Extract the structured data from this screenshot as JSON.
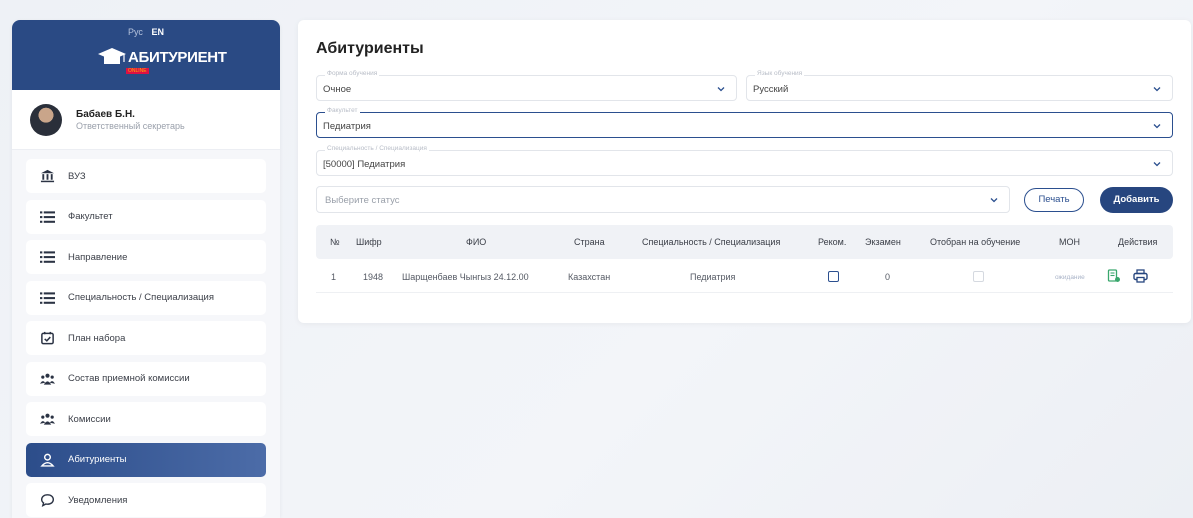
{
  "sidebar": {
    "lang_ru": "Рус",
    "lang_en": "EN",
    "logo_text": "АБИТУРИЕНТ",
    "logo_sub": "ONLINE",
    "user_name": "Бабаев Б.Н.",
    "user_role": "Ответственный секретарь",
    "items": [
      {
        "label": "ВУЗ",
        "icon": "university-icon"
      },
      {
        "label": "Факультет",
        "icon": "list-icon"
      },
      {
        "label": "Направление",
        "icon": "list-icon"
      },
      {
        "label": "Специальность / Специализация",
        "icon": "list-icon"
      },
      {
        "label": "План набора",
        "icon": "calendar-check-icon"
      },
      {
        "label": "Состав приемной комиссии",
        "icon": "users-icon"
      },
      {
        "label": "Комиссии",
        "icon": "users-icon"
      },
      {
        "label": "Абитуриенты",
        "icon": "user-icon",
        "active": true
      },
      {
        "label": "Уведомления",
        "icon": "chat-icon"
      }
    ]
  },
  "main": {
    "title": "Абитуриенты",
    "filters": {
      "form_label": "Форма обучения",
      "form_value": "Очное",
      "lang_label": "Язык обучения",
      "lang_value": "Русский",
      "faculty_label": "Факультет",
      "faculty_value": "Педиатрия",
      "spec_label": "Специальность / Специализация",
      "spec_value": "[50000] Педиатрия",
      "status_placeholder": "Выберите статус"
    },
    "print_label": "Печать",
    "add_label": "Добавить",
    "table": {
      "headers": [
        "№",
        "Шифр",
        "ФИО",
        "Страна",
        "Специальность / Специализация",
        "Реком.",
        "Экзамен",
        "Отобран на обучение",
        "МОН",
        "Действия"
      ],
      "rows": [
        {
          "num": "1",
          "code": "1948",
          "fio": "Шарщенбаев Чынгыз 24.12.00",
          "country": "Казахстан",
          "spec": "Педиатрия",
          "exam": "0",
          "mon": "ожидание"
        }
      ]
    }
  },
  "colors": {
    "primary": "#27467f",
    "accent_green": "#3aa76d"
  }
}
